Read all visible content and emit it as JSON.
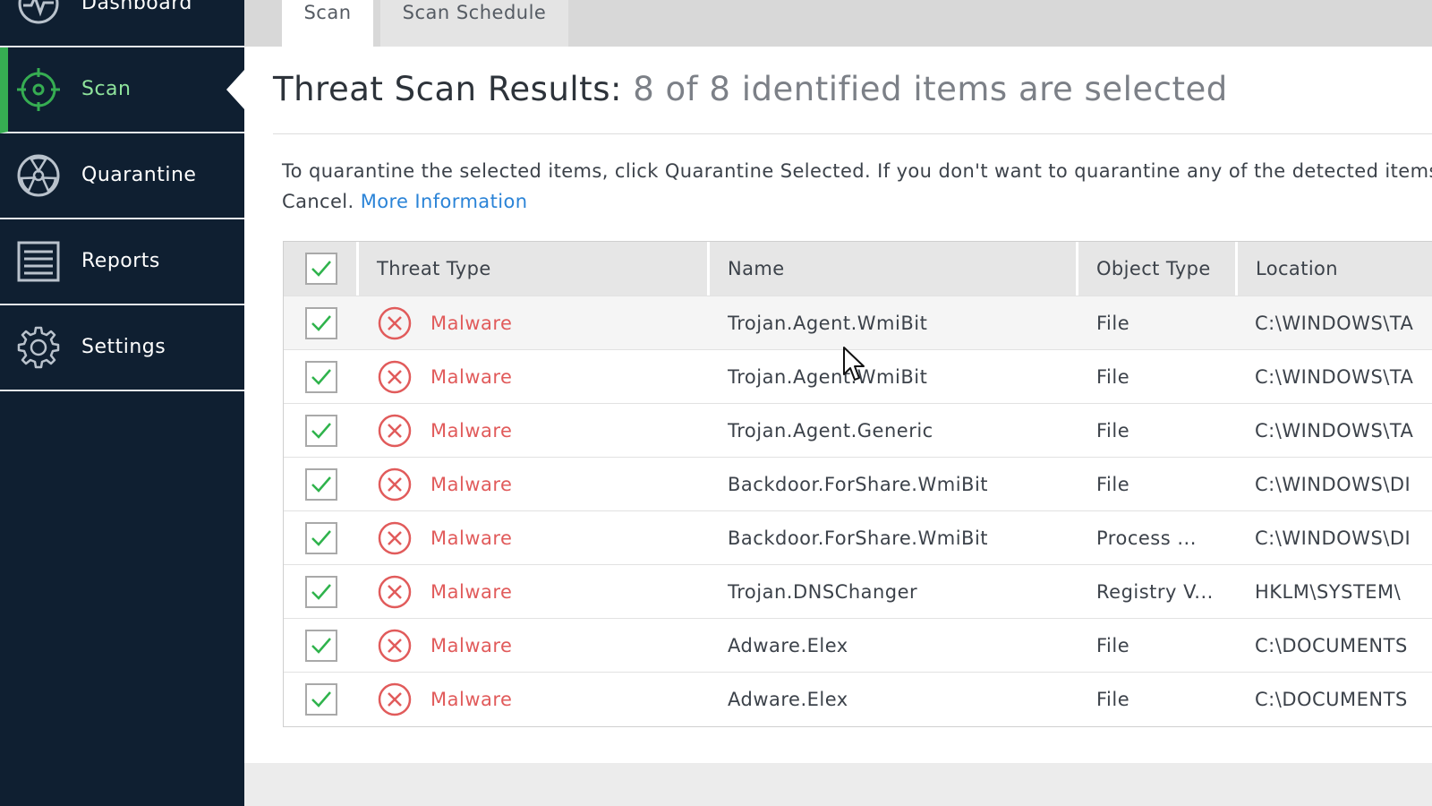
{
  "sidebar": {
    "items": [
      {
        "label": "Dashboard",
        "icon": "dashboard-icon"
      },
      {
        "label": "Scan",
        "icon": "scan-target-icon",
        "active": true
      },
      {
        "label": "Quarantine",
        "icon": "quarantine-icon"
      },
      {
        "label": "Reports",
        "icon": "reports-icon"
      },
      {
        "label": "Settings",
        "icon": "settings-gear-icon"
      }
    ]
  },
  "tabs": [
    {
      "label": "Scan",
      "active": true
    },
    {
      "label": "Scan Schedule",
      "active": false
    }
  ],
  "main": {
    "title": "Threat Scan Results:",
    "subtitle": "8 of 8 identified items are selected",
    "instructions_line1": "To quarantine the selected items, click Quarantine Selected. If you don't want to quarantine any of the detected items, click",
    "instructions_line2": "Cancel.",
    "more_info_link": "More Information"
  },
  "table": {
    "columns": [
      "Threat Type",
      "Name",
      "Object Type",
      "Location"
    ],
    "rows": [
      {
        "threat_type": "Malware",
        "name": "Trojan.Agent.WmiBit",
        "object_type": "File",
        "location": "C:\\WINDOWS\\TA",
        "checked": true
      },
      {
        "threat_type": "Malware",
        "name": "Trojan.Agent.WmiBit",
        "object_type": "File",
        "location": "C:\\WINDOWS\\TA",
        "checked": true
      },
      {
        "threat_type": "Malware",
        "name": "Trojan.Agent.Generic",
        "object_type": "File",
        "location": "C:\\WINDOWS\\TA",
        "checked": true
      },
      {
        "threat_type": "Malware",
        "name": "Backdoor.ForShare.WmiBit",
        "object_type": "File",
        "location": "C:\\WINDOWS\\DI",
        "checked": true
      },
      {
        "threat_type": "Malware",
        "name": "Backdoor.ForShare.WmiBit",
        "object_type": "Process ...",
        "location": "C:\\WINDOWS\\DI",
        "checked": true
      },
      {
        "threat_type": "Malware",
        "name": "Trojan.DNSChanger",
        "object_type": "Registry V...",
        "location": "HKLM\\SYSTEM\\",
        "checked": true
      },
      {
        "threat_type": "Malware",
        "name": "Adware.Elex",
        "object_type": "File",
        "location": "C:\\DOCUMENTS",
        "checked": true
      },
      {
        "threat_type": "Malware",
        "name": "Adware.Elex",
        "object_type": "File",
        "location": "C:\\DOCUMENTS",
        "checked": true
      }
    ]
  },
  "colors": {
    "sidebar_bg": "#0f1f31",
    "active_accent": "#36ad52",
    "threat_red": "#e15b5b",
    "check_green": "#2fb34c",
    "link_blue": "#2a83d7"
  }
}
